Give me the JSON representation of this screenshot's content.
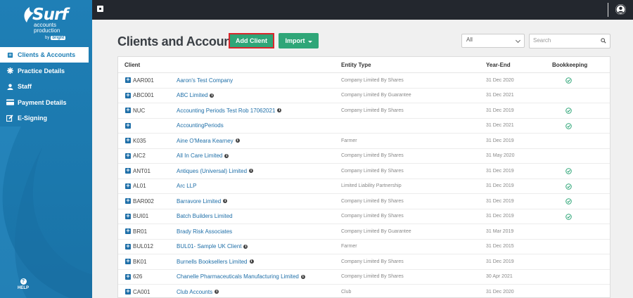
{
  "brand": {
    "name": "Surf",
    "line2": "accounts",
    "line3": "production",
    "by": "by",
    "company": "bright"
  },
  "sidebar": {
    "items": [
      {
        "label": "Clients & Accounts",
        "icon": "book-icon",
        "active": true
      },
      {
        "label": "Practice Details",
        "icon": "asterisk-icon",
        "active": false
      },
      {
        "label": "Staff",
        "icon": "user-icon",
        "active": false
      },
      {
        "label": "Payment Details",
        "icon": "credit-card-icon",
        "active": false
      },
      {
        "label": "E-Signing",
        "icon": "edit-icon",
        "active": false
      }
    ],
    "help_label": "HELP"
  },
  "main": {
    "title": "Clients and Accounts",
    "add_client_label": "Add Client",
    "import_label": "Import",
    "filter_value": "All",
    "search_placeholder": "Search"
  },
  "table": {
    "columns": [
      "Client",
      "Entity Type",
      "Year-End",
      "Bookkeeping"
    ],
    "rows": [
      {
        "code": "AAR001",
        "name": "Aaron's Test Company",
        "info": false,
        "entity": "Company Limited By Shares",
        "year_end": "31 Dec 2020",
        "bookkeeping": true
      },
      {
        "code": "ABC001",
        "name": "ABC Limited",
        "info": true,
        "entity": "Company Limited By Guarantee",
        "year_end": "31 Dec 2021",
        "bookkeeping": false
      },
      {
        "code": "NUC",
        "name": "Accounting Periods Test Rob 17062021",
        "info": true,
        "entity": "Company Limited By Shares",
        "year_end": "31 Dec 2019",
        "bookkeeping": true
      },
      {
        "code": "",
        "name": "AccountingPeriods",
        "info": false,
        "entity": "",
        "year_end": "31 Dec 2021",
        "bookkeeping": true
      },
      {
        "code": "K035",
        "name": "Aine O'Meara Kearney",
        "info": true,
        "entity": "Farmer",
        "year_end": "31 Dec 2019",
        "bookkeeping": false
      },
      {
        "code": "AIC2",
        "name": "All In Care Limited",
        "info": true,
        "entity": "Company Limited By Shares",
        "year_end": "31 May 2020",
        "bookkeeping": false
      },
      {
        "code": "ANT01",
        "name": "Antiques (Universal) Limited",
        "info": true,
        "entity": "Company Limited By Shares",
        "year_end": "31 Dec 2019",
        "bookkeeping": true
      },
      {
        "code": "AL01",
        "name": "Arc LLP",
        "info": false,
        "entity": "Limited Liability Partnership",
        "year_end": "31 Dec 2019",
        "bookkeeping": true
      },
      {
        "code": "BAR002",
        "name": "Barravore Limited",
        "info": true,
        "entity": "Company Limited By Shares",
        "year_end": "31 Dec 2019",
        "bookkeeping": true
      },
      {
        "code": "BUI01",
        "name": "Batch Builders Limited",
        "info": false,
        "entity": "Company Limited By Shares",
        "year_end": "31 Dec 2019",
        "bookkeeping": true
      },
      {
        "code": "BR01",
        "name": "Brady Risk Associates",
        "info": false,
        "entity": "Company Limited By Guarantee",
        "year_end": "31 Mar 2019",
        "bookkeeping": false
      },
      {
        "code": "BUL012",
        "name": "BUL01- Sample UK Client",
        "info": true,
        "entity": "Farmer",
        "year_end": "31 Dec 2015",
        "bookkeeping": false
      },
      {
        "code": "BK01",
        "name": "Burnells Booksellers Limited",
        "info": true,
        "entity": "Company Limited By Shares",
        "year_end": "31 Dec 2019",
        "bookkeeping": false
      },
      {
        "code": "626",
        "name": "Chanelle Pharmaceuticals Manufacturing Limited",
        "info": true,
        "entity": "Company Limited By Shares",
        "year_end": "30 Apr 2021",
        "bookkeeping": false
      },
      {
        "code": "CA001",
        "name": "Club Accounts",
        "info": true,
        "entity": "Club",
        "year_end": "31 Dec 2020",
        "bookkeeping": false
      }
    ]
  },
  "colors": {
    "sidebar": "#1f7fb6",
    "topbar": "#23272e",
    "accent_green": "#2fa678",
    "highlight_red": "#d9262c",
    "link_blue": "#1f6fa8",
    "check_green": "#2fa678"
  }
}
